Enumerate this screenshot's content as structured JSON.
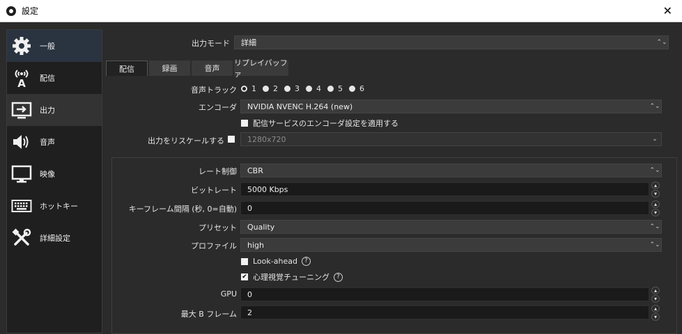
{
  "window": {
    "title": "設定",
    "close_glyph": "✕"
  },
  "sidebar": {
    "items": [
      {
        "label": "一般",
        "icon": "gear-icon"
      },
      {
        "label": "配信",
        "icon": "broadcast-icon"
      },
      {
        "label": "出力",
        "icon": "output-icon"
      },
      {
        "label": "音声",
        "icon": "speaker-icon"
      },
      {
        "label": "映像",
        "icon": "monitor-icon"
      },
      {
        "label": "ホットキー",
        "icon": "keyboard-icon"
      },
      {
        "label": "詳細設定",
        "icon": "tools-icon"
      }
    ]
  },
  "output": {
    "mode_label": "出力モード",
    "mode_value": "詳細",
    "tabs": [
      {
        "label": "配信"
      },
      {
        "label": "録画"
      },
      {
        "label": "音声"
      },
      {
        "label": "リプレイバッファ"
      }
    ],
    "audio_track_label": "音声トラック",
    "audio_tracks": [
      "1",
      "2",
      "3",
      "4",
      "5",
      "6"
    ],
    "encoder_label": "エンコーダ",
    "encoder_value": "NVIDIA NVENC H.264 (new)",
    "enforce_label": "配信サービスのエンコーダ設定を適用する",
    "rescale_label": "出力をリスケールする",
    "rescale_value": "1280x720"
  },
  "encoder_settings": {
    "rate_control_label": "レート制御",
    "rate_control_value": "CBR",
    "bitrate_label": "ビットレート",
    "bitrate_value": "5000 Kbps",
    "keyframe_label": "キーフレーム間隔 (秒, 0=自動)",
    "keyframe_value": "0",
    "preset_label": "プリセット",
    "preset_value": "Quality",
    "profile_label": "プロファイル",
    "profile_value": "high",
    "lookahead_label": "Look-ahead",
    "psycho_label": "心理視覚チューニング",
    "help_glyph": "?",
    "gpu_label": "GPU",
    "gpu_value": "0",
    "bframes_label": "最大 B フレーム",
    "bframes_value": "2"
  }
}
